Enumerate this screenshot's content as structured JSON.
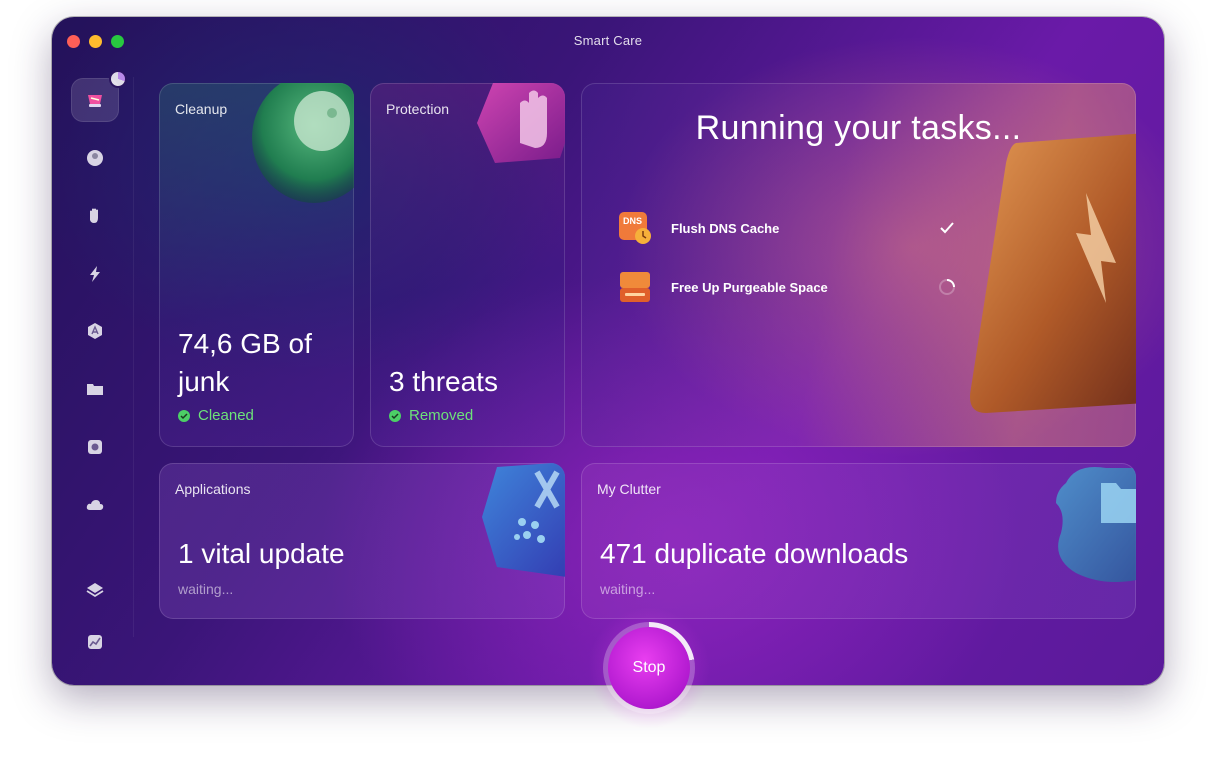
{
  "window": {
    "title": "Smart Care"
  },
  "sidebar": {
    "items": [
      {
        "icon": "smart-care-icon",
        "active": true
      },
      {
        "icon": "cleanup-icon"
      },
      {
        "icon": "protection-icon"
      },
      {
        "icon": "performance-icon"
      },
      {
        "icon": "applications-icon"
      },
      {
        "icon": "my-clutter-icon"
      },
      {
        "icon": "space-lens-icon"
      },
      {
        "icon": "cloud-cleanup-icon"
      },
      {
        "icon": "assistant-icon"
      },
      {
        "icon": "menu-app-icon"
      }
    ]
  },
  "cards": {
    "cleanup": {
      "label": "Cleanup",
      "value_line1": "74,6 GB of",
      "value_line2": "junk",
      "status": "Cleaned"
    },
    "protection": {
      "label": "Protection",
      "value": "3 threats",
      "status": "Removed"
    },
    "running": {
      "title": "Running your tasks...",
      "tasks": [
        {
          "label": "Flush DNS Cache",
          "icon_text": "DNS",
          "state": "done"
        },
        {
          "label": "Free Up Purgeable Space",
          "state": "in-progress"
        }
      ]
    },
    "applications": {
      "label": "Applications",
      "value": "1 vital update",
      "status": "waiting..."
    },
    "clutter": {
      "label": "My Clutter",
      "value": "471 duplicate downloads",
      "status": "waiting..."
    }
  },
  "stop": {
    "label": "Stop"
  },
  "colors": {
    "accent": "#c22de0",
    "success": "#4ccf66",
    "background": "#3a1578"
  }
}
